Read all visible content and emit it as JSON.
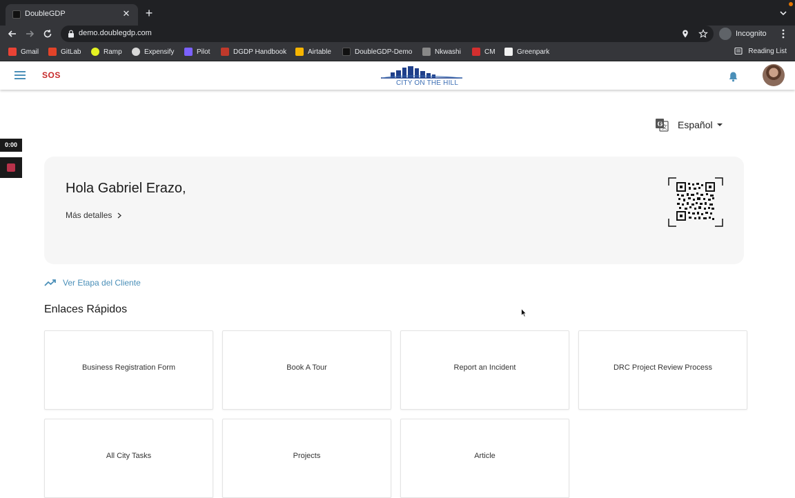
{
  "browser": {
    "tab_title": "DoubleGDP",
    "url": "demo.doublegdp.com",
    "profile_label": "Incognito",
    "bookmarks": [
      {
        "label": "Gmail",
        "icon": "gmail-icon",
        "color": "#ea4335"
      },
      {
        "label": "GitLab",
        "icon": "gitlab-icon",
        "color": "#e24329"
      },
      {
        "label": "Ramp",
        "icon": "ramp-icon",
        "color": "#e4f222"
      },
      {
        "label": "Expensify",
        "icon": "expensify-icon",
        "color": "#d8d8d8"
      },
      {
        "label": "Pilot",
        "icon": "pilot-icon",
        "color": "#7b61ff"
      },
      {
        "label": "DGDP Handbook",
        "icon": "handbook-icon",
        "color": "#c0392b"
      },
      {
        "label": "Airtable",
        "icon": "airtable-icon",
        "color": "#f7b500"
      },
      {
        "label": "DoubleGDP-Demo",
        "icon": "doublegdp-icon",
        "color": "#111111"
      },
      {
        "label": "Nkwashi",
        "icon": "nkwashi-icon",
        "color": "#888888"
      },
      {
        "label": "CM",
        "icon": "cm-icon",
        "color": "#d32f2f"
      },
      {
        "label": "Greenpark",
        "icon": "greenpark-icon",
        "color": "#f1f1f1"
      }
    ],
    "reading_list_label": "Reading List"
  },
  "header": {
    "sos_label": "SOS",
    "logo_text": "CITY ON THE HILL",
    "accent_color": "#4a8fb8"
  },
  "recorder": {
    "time": "0:00"
  },
  "language": {
    "selected": "Español"
  },
  "welcome": {
    "greeting": "Hola Gabriel Erazo,",
    "details_link": "Más detalles"
  },
  "journey_link": "Ver Etapa del Cliente",
  "quick_links": {
    "title": "Enlaces Rápidos",
    "items": [
      "Business Registration Form",
      "Book A Tour",
      "Report an Incident",
      "DRC Project Review Process",
      "All City Tasks",
      "Projects",
      "Article"
    ]
  }
}
